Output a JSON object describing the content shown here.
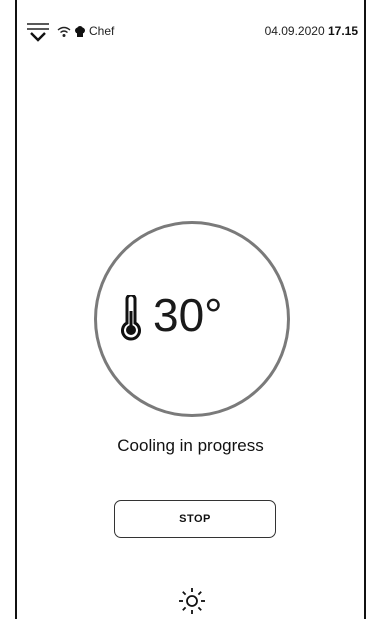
{
  "status_bar": {
    "profile_label": "Chef",
    "date": "04.09.2020",
    "time": "17.15"
  },
  "icons": {
    "menu": "menu-chevron-icon",
    "wifi": "wifi-icon",
    "profile": "chef-hat-icon",
    "temperature": "thermometer-icon",
    "light": "sun-icon"
  },
  "dial": {
    "temperature": "30°"
  },
  "status": {
    "text": "Cooling in progress"
  },
  "actions": {
    "stop_label": "STOP"
  },
  "colors": {
    "dial_ring": "#7a7a7a",
    "text": "#1a1a1a",
    "background": "#ffffff"
  }
}
